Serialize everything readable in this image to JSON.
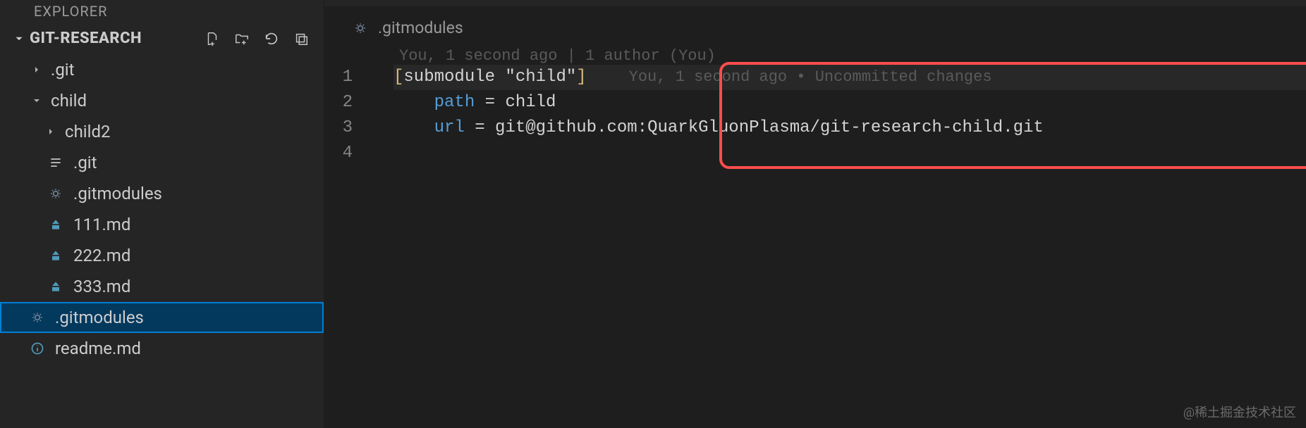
{
  "explorer": {
    "title": "EXPLORER",
    "root": "GIT-RESEARCH",
    "actions": [
      "new-file",
      "new-folder",
      "refresh",
      "collapse-all"
    ]
  },
  "tree": {
    "git_folder": ".git",
    "child_folder": "child",
    "child2_folder": "child2",
    "child_git_file": ".git",
    "child_gitmodules": ".gitmodules",
    "f111": "111.md",
    "f222": "222.md",
    "f333": "333.md",
    "root_gitmodules": ".gitmodules",
    "readme": "readme.md"
  },
  "breadcrumb": {
    "filename": ".gitmodules"
  },
  "annot_top": "You, 1 second ago | 1 author (You)",
  "code": {
    "line1_open": "[",
    "line1_body": "submodule \"child\"",
    "line1_close": "]",
    "blame": "You, 1 second ago • Uncommitted changes",
    "line2_key": "path",
    "line2_eq": " = ",
    "line2_val": "child",
    "line3_key": "url",
    "line3_eq": " = ",
    "line3_val": "git@github.com:QuarkGluonPlasma/git-research-child.git",
    "indent": "    ",
    "ln1": "1",
    "ln2": "2",
    "ln3": "3",
    "ln4": "4"
  },
  "watermark": "@稀土掘金技术社区"
}
